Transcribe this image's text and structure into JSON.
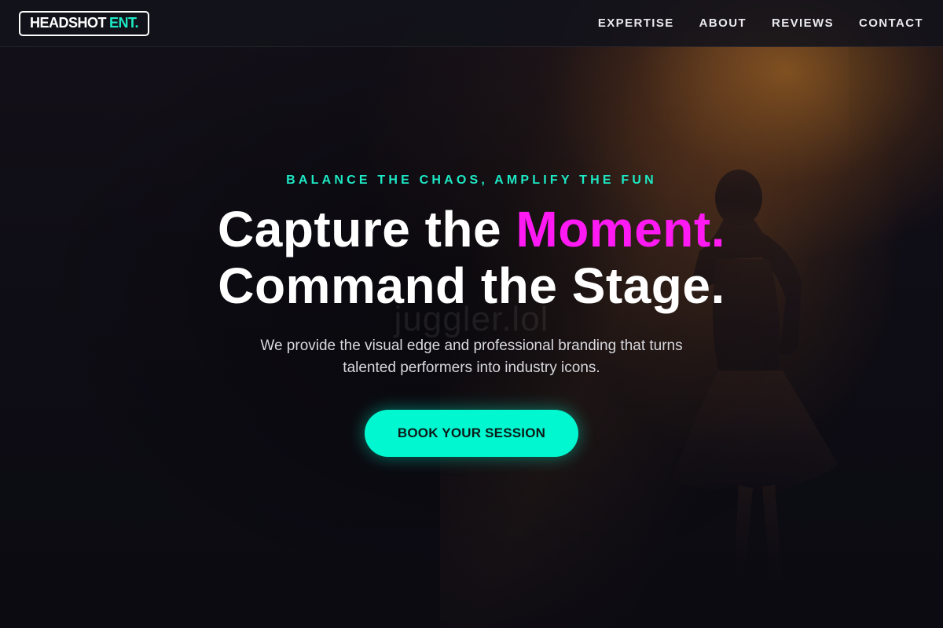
{
  "header": {
    "logo": {
      "text": "HEADSHOT",
      "accent": "ENT."
    },
    "nav": [
      {
        "label": "EXPERTISE"
      },
      {
        "label": "ABOUT"
      },
      {
        "label": "REVIEWS"
      },
      {
        "label": "CONTACT"
      }
    ]
  },
  "hero": {
    "eyebrow": "BALANCE THE CHAOS, AMPLIFY THE FUN",
    "headline": {
      "line1_prefix": "Capture the",
      "line1_highlight": "Moment.",
      "line2": "Command the Stage."
    },
    "watermark": "juggler.lol",
    "subtitle": {
      "line1": "We provide the visual edge and professional branding that turns",
      "line2": "talented performers into industry icons."
    },
    "cta_label": "BOOK YOUR SESSION"
  },
  "colors": {
    "accent_teal": "#1de9c5",
    "accent_magenta": "#ff1af3",
    "cta_background": "#00f7cf",
    "background": "#0d0c13"
  },
  "images": {
    "background": "stage-performer-photo"
  }
}
